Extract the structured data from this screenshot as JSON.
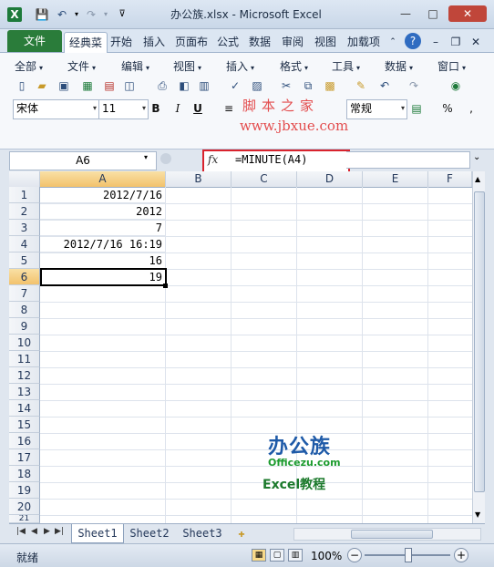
{
  "window": {
    "title": "办公族.xlsx - Microsoft Excel",
    "app_icon": "X"
  },
  "tabs": {
    "file": "文件",
    "items": [
      "经典菜",
      "开始",
      "插入",
      "页面布",
      "公式",
      "数据",
      "审阅",
      "视图",
      "加载项"
    ],
    "active_index": 0
  },
  "menus": [
    "全部",
    "文件",
    "编辑",
    "视图",
    "插入",
    "格式",
    "工具",
    "数据",
    "窗口"
  ],
  "format": {
    "font_name": "宋体",
    "font_size": "11",
    "bold": "B",
    "italic": "I",
    "underline": "U",
    "number_format": "常规",
    "percent": "%"
  },
  "watermark": {
    "line1": "脚本之家",
    "line2": "www.jbxue.com"
  },
  "formula_bar": {
    "name_box": "A6",
    "fx": "fx",
    "formula": "=MINUTE(A4)"
  },
  "grid": {
    "columns": [
      "A",
      "B",
      "C",
      "D",
      "E",
      "F"
    ],
    "rows": [
      "1",
      "2",
      "3",
      "4",
      "5",
      "6",
      "7",
      "8",
      "9",
      "10",
      "11",
      "12",
      "13",
      "14",
      "15",
      "16",
      "17",
      "18",
      "19",
      "20",
      "21"
    ],
    "cells": [
      "2012/7/16",
      "2012",
      "7",
      "2012/7/16 16:19",
      "16",
      "19"
    ],
    "active_cell": "A6"
  },
  "logo": {
    "name": "办公族",
    "url": "Officezu.com",
    "subtitle": "Excel教程"
  },
  "sheets": {
    "tabs": [
      "Sheet1",
      "Sheet2",
      "Sheet3"
    ],
    "active_index": 0
  },
  "status": {
    "text": "就绪",
    "zoom": "100%"
  },
  "colors": {
    "file_tab": "#2a7c3a",
    "highlight_box": "#d9232d",
    "selected_header": "#f2c26c"
  }
}
